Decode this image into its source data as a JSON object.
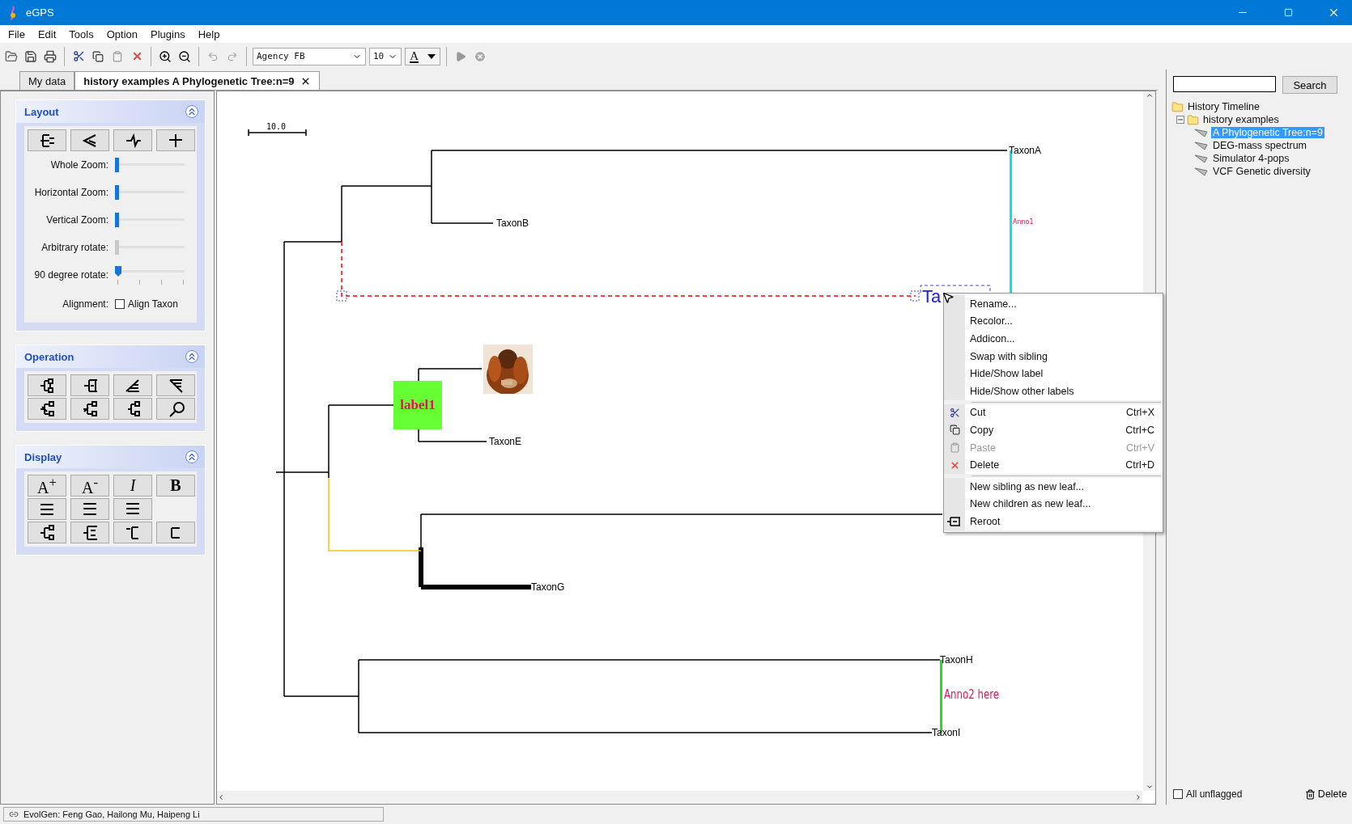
{
  "window": {
    "title": "eGPS"
  },
  "menu_bar": [
    "File",
    "Edit",
    "Tools",
    "Option",
    "Plugins",
    "Help"
  ],
  "toolbar": {
    "font_name": "Agency FB",
    "font_size": "10",
    "font_color_letter": "A"
  },
  "tabs": [
    {
      "label": "My data",
      "selected": false
    },
    {
      "label": "history examples A Phylogenetic Tree:n=9",
      "selected": true
    }
  ],
  "layout_panel": {
    "title": "Layout",
    "sliders": [
      {
        "label": "Whole Zoom:",
        "level": 0,
        "disabled": false,
        "kind": "plain"
      },
      {
        "label": "Horizontal Zoom:",
        "level": 0,
        "disabled": false,
        "kind": "plain"
      },
      {
        "label": "Vertical Zoom:",
        "level": 0,
        "disabled": false,
        "kind": "plain"
      },
      {
        "label": "Arbitrary rotate:",
        "level": 0,
        "disabled": true,
        "kind": "plain"
      },
      {
        "label": "90 degree rotate:",
        "level": 0,
        "disabled": false,
        "kind": "ticked"
      }
    ],
    "alignment": {
      "label": "Alignment:",
      "option": "Align Taxon",
      "checked": false
    }
  },
  "operation_panel": {
    "title": "Operation"
  },
  "display_panel": {
    "title": "Display",
    "buttons": [
      {
        "kind": "text",
        "label": "A$^{+}$"
      },
      {
        "kind": "text",
        "label": "A$^{-}$"
      },
      {
        "kind": "italic",
        "label": "I"
      },
      {
        "kind": "bold",
        "label": "B"
      }
    ]
  },
  "tree": {
    "scale_label": "10.0",
    "labels": [
      "TaxonA",
      "TaxonB",
      "Ta",
      "TaxonE",
      "TaxonG",
      "TaxonH",
      "TaxonI"
    ],
    "node_label": "label1",
    "annotations": [
      "Anno1",
      "Anno2 here"
    ]
  },
  "context_menu": {
    "items": [
      {
        "kind": "item",
        "label": "Rename...",
        "disabled": false
      },
      {
        "kind": "item",
        "label": "Recolor...",
        "disabled": false
      },
      {
        "kind": "item",
        "label": "Addicon...",
        "disabled": false
      },
      {
        "kind": "item",
        "label": "Swap with sibling",
        "disabled": false
      },
      {
        "kind": "item",
        "label": "Hide/Show label",
        "disabled": false
      },
      {
        "kind": "item",
        "label": "Hide/Show other labels",
        "disabled": false
      },
      {
        "kind": "separator"
      },
      {
        "kind": "item",
        "label": "Cut",
        "shortcut": "Ctrl+X",
        "disabled": false
      },
      {
        "kind": "item",
        "label": "Copy",
        "shortcut": "Ctrl+C",
        "disabled": false
      },
      {
        "kind": "item",
        "label": "Paste",
        "shortcut": "Ctrl+V",
        "disabled": true
      },
      {
        "kind": "item",
        "label": "Delete",
        "shortcut": "Ctrl+D",
        "disabled": false
      },
      {
        "kind": "separator"
      },
      {
        "kind": "item",
        "label": "New sibling as new leaf...",
        "disabled": false
      },
      {
        "kind": "item",
        "label": "New children as new leaf...",
        "disabled": false
      },
      {
        "kind": "item",
        "label": "Reroot",
        "disabled": false
      }
    ]
  },
  "right_panel": {
    "search_button": "Search",
    "history": {
      "label": "History Timeline",
      "children": [
        {
          "label": "history examples",
          "expanded": true,
          "children": [
            {
              "label": "A Phylogenetic Tree:n=9",
              "selected": true
            },
            {
              "label": "DEG-mass spectrum",
              "selected": false
            },
            {
              "label": "Simulator 4-pops",
              "selected": false
            },
            {
              "label": "VCF Genetic diversity",
              "selected": false
            }
          ]
        }
      ]
    },
    "all_unflagged": {
      "label": "All unflagged",
      "checked": false
    },
    "delete_button": "Delete"
  },
  "status_bar": {
    "text": "EvolGen: Feng Gao,  Hailong Mu,  Haipeng Li"
  }
}
